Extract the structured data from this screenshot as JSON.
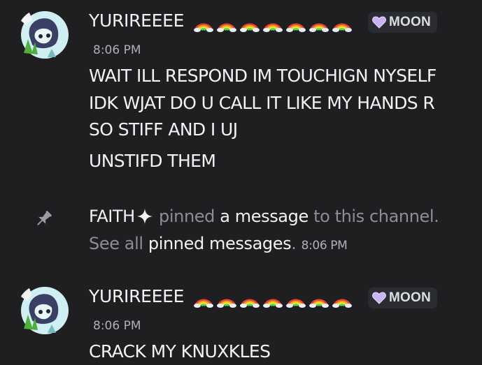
{
  "messages": [
    {
      "author": "YURIREEEE",
      "badge_emoji": "rainbow-emoji",
      "badge_count": 7,
      "role": "MOON",
      "role_color": "#c9b3f5",
      "time": "8:06 PM",
      "lines": [
        "WAIT ILL RESPOND IM TOUCHIGN NYSELF",
        "IDK WJAT DO U CALL IT LIKE MY HANDS R",
        "SO STIFF AND I UJ",
        "UNSTIFD THEM"
      ]
    },
    {
      "author": "YURIREEEE",
      "badge_emoji": "rainbow-emoji",
      "badge_count": 7,
      "role": "MOON",
      "role_color": "#c9b3f5",
      "time": "8:06 PM",
      "lines": [
        "CRACK MY KNUXKLES"
      ]
    }
  ],
  "pin_notice": {
    "user": "FAITH",
    "user_suffix_icon": "sparkle-icon",
    "text_before": "pinned",
    "link_message": "a message",
    "text_after": "to this channel.",
    "see_all": "See all",
    "link_pinned": "pinned messages",
    "period": ".",
    "time": "8:06 PM"
  },
  "colors": {
    "background": "#1f1f22",
    "text": "#f2f3f5",
    "muted": "#8c8e96",
    "timestamp": "#aeb0b7",
    "role_tag_bg": "#2b2c31"
  }
}
